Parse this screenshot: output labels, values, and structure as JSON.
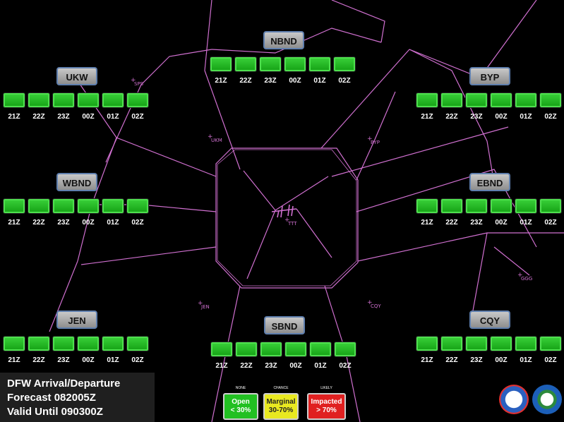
{
  "groups": {
    "nbnd": {
      "label": "NBND",
      "times": [
        "21Z",
        "22Z",
        "23Z",
        "00Z",
        "01Z",
        "02Z"
      ]
    },
    "ukw": {
      "label": "UKW",
      "times": [
        "21Z",
        "22Z",
        "23Z",
        "00Z",
        "01Z",
        "02Z"
      ]
    },
    "byp": {
      "label": "BYP",
      "times": [
        "21Z",
        "22Z",
        "23Z",
        "00Z",
        "01Z",
        "02Z"
      ]
    },
    "wbnd": {
      "label": "WBND",
      "times": [
        "21Z",
        "22Z",
        "23Z",
        "00Z",
        "01Z",
        "02Z"
      ]
    },
    "ebnd": {
      "label": "EBND",
      "times": [
        "21Z",
        "22Z",
        "23Z",
        "00Z",
        "01Z",
        "02Z"
      ]
    },
    "jen": {
      "label": "JEN",
      "times": [
        "21Z",
        "22Z",
        "23Z",
        "00Z",
        "01Z",
        "02Z"
      ]
    },
    "sbnd": {
      "label": "SBND",
      "times": [
        "21Z",
        "22Z",
        "23Z",
        "00Z",
        "01Z",
        "02Z"
      ]
    },
    "cqy": {
      "label": "CQY",
      "times": [
        "21Z",
        "22Z",
        "23Z",
        "00Z",
        "01Z",
        "02Z"
      ]
    }
  },
  "fixes": {
    "sps": "SPS",
    "ukm": "UKM",
    "byp": "BYP",
    "ttt": "TTT",
    "ggg": "GGG",
    "jen": "JEN",
    "cqy": "CQY"
  },
  "info": {
    "line1": "DFW Arrival/Departure",
    "line2": "Forecast 082005Z",
    "line3": "Valid Until  090300Z"
  },
  "legend": {
    "open": {
      "caption": "NONE",
      "line1": "Open",
      "line2": "< 30%"
    },
    "marginal": {
      "caption": "CHANCE",
      "line1": "Marginal",
      "line2": "30-70%"
    },
    "impacted": {
      "caption": "LIKELY",
      "line1": "Impacted",
      "line2": "> 70%"
    }
  },
  "colors": {
    "background": "#000000",
    "route_lines": "#d070d0",
    "open": "#22c022",
    "marginal": "#e8e820",
    "impacted": "#e02020",
    "label_border": "#5f7fae"
  }
}
